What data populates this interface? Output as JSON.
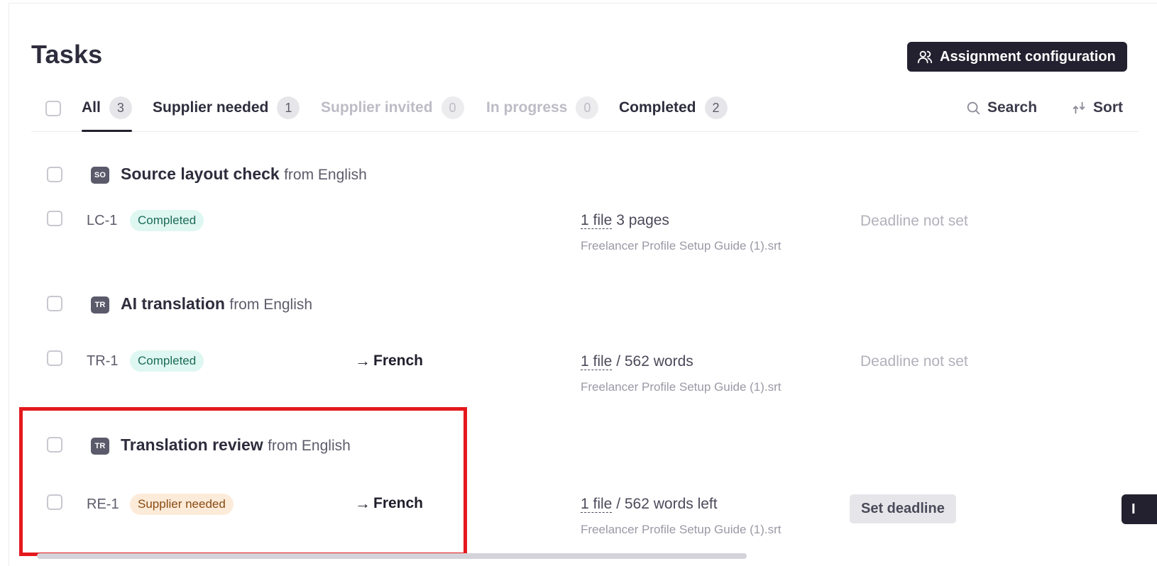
{
  "page": {
    "title": "Tasks"
  },
  "header": {
    "assign_button_label": "Assignment configuration"
  },
  "tabs": [
    {
      "label": "All",
      "count": "3",
      "active": true
    },
    {
      "label": "Supplier needed",
      "count": "1"
    },
    {
      "label": "Supplier invited",
      "count": "0"
    },
    {
      "label": "In progress",
      "count": "0"
    },
    {
      "label": "Completed",
      "count": "2"
    }
  ],
  "toolbar": {
    "search_label": "Search",
    "sort_label": "Sort"
  },
  "groups": [
    {
      "icon": "SO",
      "title": "Source layout check",
      "from": "from English",
      "task": {
        "id": "LC-1",
        "status": "Completed",
        "target": "",
        "file_link": "1 file",
        "file_detail": " 3 pages",
        "file_name": "Freelancer Profile Setup Guide (1).srt",
        "deadline": "Deadline not set"
      }
    },
    {
      "icon": "TR",
      "title": "AI translation",
      "from": "from English",
      "task": {
        "id": "TR-1",
        "status": "Completed",
        "target_arrow": "→",
        "target": "French",
        "file_link": "1 file",
        "file_detail": " / 562 words",
        "file_name": "Freelancer Profile Setup Guide (1).srt",
        "deadline": "Deadline not set"
      }
    },
    {
      "icon": "TR",
      "title": "Translation review",
      "from": "from English",
      "task": {
        "id": "RE-1",
        "status": "Supplier needed",
        "target_arrow": "→",
        "target": "French",
        "file_link": "1 file",
        "file_detail": " / 562 words left",
        "file_name": "Freelancer Profile Setup Guide (1).srt",
        "deadline_button": "Set deadline",
        "edge_button": "I"
      }
    }
  ],
  "colors": {
    "primary_dark": "#23212f",
    "completed_bg": "#dff7f1",
    "supplier_needed_bg": "#fdebd9",
    "highlight": "#e4191d"
  }
}
